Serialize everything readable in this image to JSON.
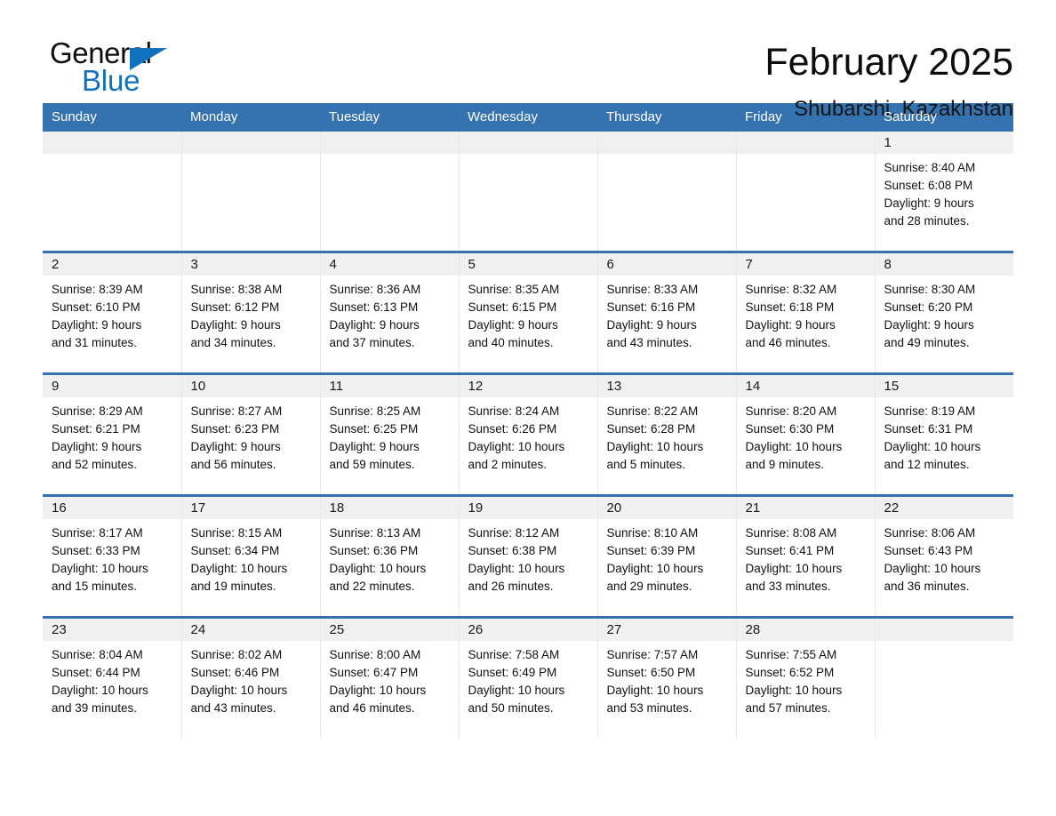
{
  "brand": {
    "name_part1": "General",
    "name_part2": "Blue",
    "triangle_color": "#1271bd"
  },
  "header": {
    "title": "February 2025",
    "location": "Shubarshi, Kazakhstan",
    "accent_color": "#3572b0",
    "band_color": "#f0f0f0"
  },
  "weekday_headers": [
    "Sunday",
    "Monday",
    "Tuesday",
    "Wednesday",
    "Thursday",
    "Friday",
    "Saturday"
  ],
  "weeks": [
    {
      "days": [
        {
          "date": "",
          "empty": true,
          "sunrise": "",
          "sunset": "",
          "daylight_line1": "",
          "daylight_line2": ""
        },
        {
          "date": "",
          "empty": true,
          "sunrise": "",
          "sunset": "",
          "daylight_line1": "",
          "daylight_line2": ""
        },
        {
          "date": "",
          "empty": true,
          "sunrise": "",
          "sunset": "",
          "daylight_line1": "",
          "daylight_line2": ""
        },
        {
          "date": "",
          "empty": true,
          "sunrise": "",
          "sunset": "",
          "daylight_line1": "",
          "daylight_line2": ""
        },
        {
          "date": "",
          "empty": true,
          "sunrise": "",
          "sunset": "",
          "daylight_line1": "",
          "daylight_line2": ""
        },
        {
          "date": "",
          "empty": true,
          "sunrise": "",
          "sunset": "",
          "daylight_line1": "",
          "daylight_line2": ""
        },
        {
          "date": "1",
          "empty": false,
          "sunrise": "Sunrise: 8:40 AM",
          "sunset": "Sunset: 6:08 PM",
          "daylight_line1": "Daylight: 9 hours",
          "daylight_line2": "and 28 minutes."
        }
      ]
    },
    {
      "days": [
        {
          "date": "2",
          "empty": false,
          "sunrise": "Sunrise: 8:39 AM",
          "sunset": "Sunset: 6:10 PM",
          "daylight_line1": "Daylight: 9 hours",
          "daylight_line2": "and 31 minutes."
        },
        {
          "date": "3",
          "empty": false,
          "sunrise": "Sunrise: 8:38 AM",
          "sunset": "Sunset: 6:12 PM",
          "daylight_line1": "Daylight: 9 hours",
          "daylight_line2": "and 34 minutes."
        },
        {
          "date": "4",
          "empty": false,
          "sunrise": "Sunrise: 8:36 AM",
          "sunset": "Sunset: 6:13 PM",
          "daylight_line1": "Daylight: 9 hours",
          "daylight_line2": "and 37 minutes."
        },
        {
          "date": "5",
          "empty": false,
          "sunrise": "Sunrise: 8:35 AM",
          "sunset": "Sunset: 6:15 PM",
          "daylight_line1": "Daylight: 9 hours",
          "daylight_line2": "and 40 minutes."
        },
        {
          "date": "6",
          "empty": false,
          "sunrise": "Sunrise: 8:33 AM",
          "sunset": "Sunset: 6:16 PM",
          "daylight_line1": "Daylight: 9 hours",
          "daylight_line2": "and 43 minutes."
        },
        {
          "date": "7",
          "empty": false,
          "sunrise": "Sunrise: 8:32 AM",
          "sunset": "Sunset: 6:18 PM",
          "daylight_line1": "Daylight: 9 hours",
          "daylight_line2": "and 46 minutes."
        },
        {
          "date": "8",
          "empty": false,
          "sunrise": "Sunrise: 8:30 AM",
          "sunset": "Sunset: 6:20 PM",
          "daylight_line1": "Daylight: 9 hours",
          "daylight_line2": "and 49 minutes."
        }
      ]
    },
    {
      "days": [
        {
          "date": "9",
          "empty": false,
          "sunrise": "Sunrise: 8:29 AM",
          "sunset": "Sunset: 6:21 PM",
          "daylight_line1": "Daylight: 9 hours",
          "daylight_line2": "and 52 minutes."
        },
        {
          "date": "10",
          "empty": false,
          "sunrise": "Sunrise: 8:27 AM",
          "sunset": "Sunset: 6:23 PM",
          "daylight_line1": "Daylight: 9 hours",
          "daylight_line2": "and 56 minutes."
        },
        {
          "date": "11",
          "empty": false,
          "sunrise": "Sunrise: 8:25 AM",
          "sunset": "Sunset: 6:25 PM",
          "daylight_line1": "Daylight: 9 hours",
          "daylight_line2": "and 59 minutes."
        },
        {
          "date": "12",
          "empty": false,
          "sunrise": "Sunrise: 8:24 AM",
          "sunset": "Sunset: 6:26 PM",
          "daylight_line1": "Daylight: 10 hours",
          "daylight_line2": "and 2 minutes."
        },
        {
          "date": "13",
          "empty": false,
          "sunrise": "Sunrise: 8:22 AM",
          "sunset": "Sunset: 6:28 PM",
          "daylight_line1": "Daylight: 10 hours",
          "daylight_line2": "and 5 minutes."
        },
        {
          "date": "14",
          "empty": false,
          "sunrise": "Sunrise: 8:20 AM",
          "sunset": "Sunset: 6:30 PM",
          "daylight_line1": "Daylight: 10 hours",
          "daylight_line2": "and 9 minutes."
        },
        {
          "date": "15",
          "empty": false,
          "sunrise": "Sunrise: 8:19 AM",
          "sunset": "Sunset: 6:31 PM",
          "daylight_line1": "Daylight: 10 hours",
          "daylight_line2": "and 12 minutes."
        }
      ]
    },
    {
      "days": [
        {
          "date": "16",
          "empty": false,
          "sunrise": "Sunrise: 8:17 AM",
          "sunset": "Sunset: 6:33 PM",
          "daylight_line1": "Daylight: 10 hours",
          "daylight_line2": "and 15 minutes."
        },
        {
          "date": "17",
          "empty": false,
          "sunrise": "Sunrise: 8:15 AM",
          "sunset": "Sunset: 6:34 PM",
          "daylight_line1": "Daylight: 10 hours",
          "daylight_line2": "and 19 minutes."
        },
        {
          "date": "18",
          "empty": false,
          "sunrise": "Sunrise: 8:13 AM",
          "sunset": "Sunset: 6:36 PM",
          "daylight_line1": "Daylight: 10 hours",
          "daylight_line2": "and 22 minutes."
        },
        {
          "date": "19",
          "empty": false,
          "sunrise": "Sunrise: 8:12 AM",
          "sunset": "Sunset: 6:38 PM",
          "daylight_line1": "Daylight: 10 hours",
          "daylight_line2": "and 26 minutes."
        },
        {
          "date": "20",
          "empty": false,
          "sunrise": "Sunrise: 8:10 AM",
          "sunset": "Sunset: 6:39 PM",
          "daylight_line1": "Daylight: 10 hours",
          "daylight_line2": "and 29 minutes."
        },
        {
          "date": "21",
          "empty": false,
          "sunrise": "Sunrise: 8:08 AM",
          "sunset": "Sunset: 6:41 PM",
          "daylight_line1": "Daylight: 10 hours",
          "daylight_line2": "and 33 minutes."
        },
        {
          "date": "22",
          "empty": false,
          "sunrise": "Sunrise: 8:06 AM",
          "sunset": "Sunset: 6:43 PM",
          "daylight_line1": "Daylight: 10 hours",
          "daylight_line2": "and 36 minutes."
        }
      ]
    },
    {
      "days": [
        {
          "date": "23",
          "empty": false,
          "sunrise": "Sunrise: 8:04 AM",
          "sunset": "Sunset: 6:44 PM",
          "daylight_line1": "Daylight: 10 hours",
          "daylight_line2": "and 39 minutes."
        },
        {
          "date": "24",
          "empty": false,
          "sunrise": "Sunrise: 8:02 AM",
          "sunset": "Sunset: 6:46 PM",
          "daylight_line1": "Daylight: 10 hours",
          "daylight_line2": "and 43 minutes."
        },
        {
          "date": "25",
          "empty": false,
          "sunrise": "Sunrise: 8:00 AM",
          "sunset": "Sunset: 6:47 PM",
          "daylight_line1": "Daylight: 10 hours",
          "daylight_line2": "and 46 minutes."
        },
        {
          "date": "26",
          "empty": false,
          "sunrise": "Sunrise: 7:58 AM",
          "sunset": "Sunset: 6:49 PM",
          "daylight_line1": "Daylight: 10 hours",
          "daylight_line2": "and 50 minutes."
        },
        {
          "date": "27",
          "empty": false,
          "sunrise": "Sunrise: 7:57 AM",
          "sunset": "Sunset: 6:50 PM",
          "daylight_line1": "Daylight: 10 hours",
          "daylight_line2": "and 53 minutes."
        },
        {
          "date": "28",
          "empty": false,
          "sunrise": "Sunrise: 7:55 AM",
          "sunset": "Sunset: 6:52 PM",
          "daylight_line1": "Daylight: 10 hours",
          "daylight_line2": "and 57 minutes."
        },
        {
          "date": "",
          "empty": true,
          "sunrise": "",
          "sunset": "",
          "daylight_line1": "",
          "daylight_line2": ""
        }
      ]
    }
  ]
}
